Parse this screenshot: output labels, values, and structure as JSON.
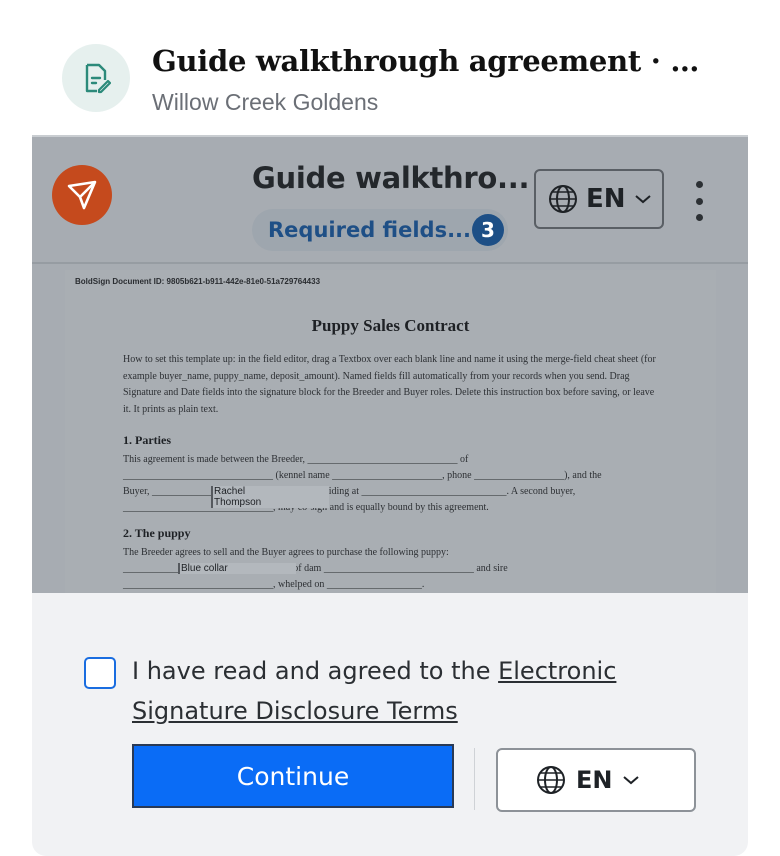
{
  "header": {
    "title": "Guide walkthrough agreement · Review and sign",
    "subtitle": "Willow Creek Goldens",
    "icon": "document-signature-icon"
  },
  "app": {
    "logo": "boldsign-logo-icon",
    "doc_title": "Guide walkthro...",
    "required_label": "Required fields...",
    "required_count": "3",
    "language": "EN",
    "more_icon": "more-vertical-icon"
  },
  "document": {
    "doc_id": "BoldSign Document ID: 9805b621-b911-442e-81e0-51a729764433",
    "title": "Puppy Sales Contract",
    "instructions": "How to set this template up: in the field editor, drag a Textbox over each blank line and name it using the merge-field cheat sheet (for example buyer_name, puppy_name, deposit_amount). Named fields fill automatically from your records when you send. Drag Signature and Date fields into the signature block for the Breeder and Buyer roles. Delete this instruction box before saving, or leave it. It prints as plain text.",
    "section1": "1. Parties",
    "s1_line1": "This agreement is made between the Breeder, ______________________________ of",
    "s1_line2": "______________________________ (kennel name ______________________, phone __________________), and the",
    "s1_line3": "Buyer, ________________________________, residing at _____________________________. A second buyer,",
    "s1_line4": "______________________________, may co-sign and is equally bound by this agreement.",
    "field_buyer1": "Rachel",
    "field_buyer2": "Thompson",
    "section2": "2. The puppy",
    "s2_line1": "The Breeder agrees to sell and the Buyer agrees to purchase the following puppy:",
    "s2_line2": "______________________________, out of dam ______________________________ and sire",
    "s2_line3": "______________________________, whelped on ___________________.",
    "field_puppy": "Blue collar"
  },
  "consent": {
    "text_prefix": "I have read and agreed to the ",
    "link_text": "Electronic Signature Disclosure Terms",
    "continue_label": "Continue",
    "language": "EN"
  },
  "colors": {
    "primary_button": "#0a6cf6",
    "logo": "#c54a1d",
    "badge": "#1d4f86"
  }
}
